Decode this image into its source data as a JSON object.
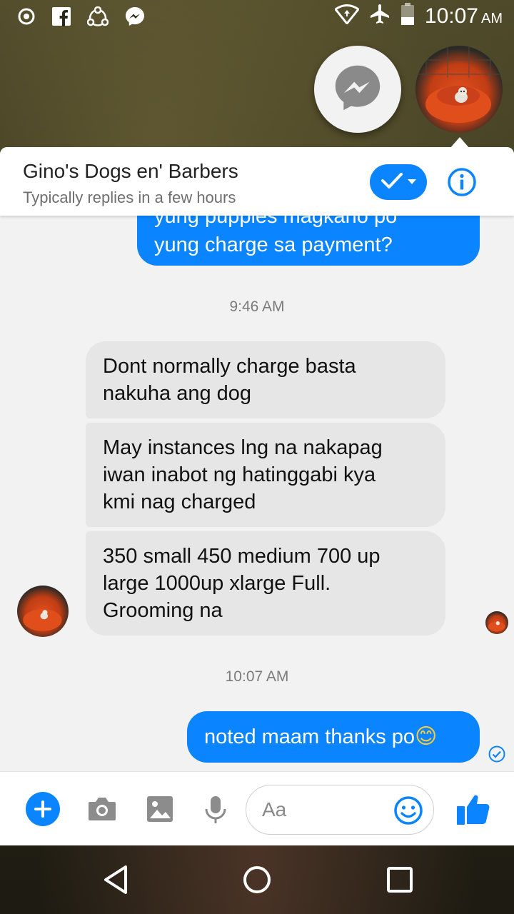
{
  "status_bar": {
    "time": "10:07",
    "ampm": "AM",
    "icons_left": [
      "record-icon",
      "facebook-icon",
      "sync-icon",
      "messenger-icon"
    ],
    "icons_right": [
      "wifi-icon",
      "airplane-mode-icon",
      "battery-icon"
    ]
  },
  "chat_heads": [
    {
      "name": "messenger-chat-head",
      "icon": "messenger-icon"
    },
    {
      "name": "contact-chat-head",
      "icon": "avatar"
    }
  ],
  "header": {
    "title": "Gino's Dogs en' Barbers",
    "subtitle": "Typically replies in a few hours",
    "check_icon": "checkmark-icon",
    "info_icon": "info-icon"
  },
  "messages": {
    "outgoing_partial_line1": "yung puppies magkano po",
    "outgoing_partial_line2": "yung charge sa payment?",
    "timestamp_1": "9:46 AM",
    "incoming": [
      {
        "lines": [
          "Dont normally charge basta",
          "nakuha ang dog"
        ]
      },
      {
        "lines": [
          "May instances lng na nakapag",
          "iwan inabot ng hatinggabi kya",
          "kmi nag charged"
        ]
      },
      {
        "lines": [
          "350 small 450 medium 700 up",
          "large 1000up xlarge Full.",
          "Grooming na"
        ]
      }
    ],
    "timestamp_2": "10:07 AM",
    "outgoing_last": "noted maam thanks po",
    "outgoing_last_emoji": "😊"
  },
  "composer": {
    "placeholder": "Aa",
    "icons": [
      "plus-icon",
      "camera-icon",
      "image-icon",
      "microphone-icon",
      "emoji-icon",
      "thumbs-up-icon"
    ]
  },
  "nav_bar": {
    "buttons": [
      "back-button",
      "home-button",
      "recents-button"
    ]
  },
  "colors": {
    "accent": "#0a84ff",
    "incoming_bubble": "#e6e6e6",
    "panel_bg": "#f2f2f2"
  }
}
